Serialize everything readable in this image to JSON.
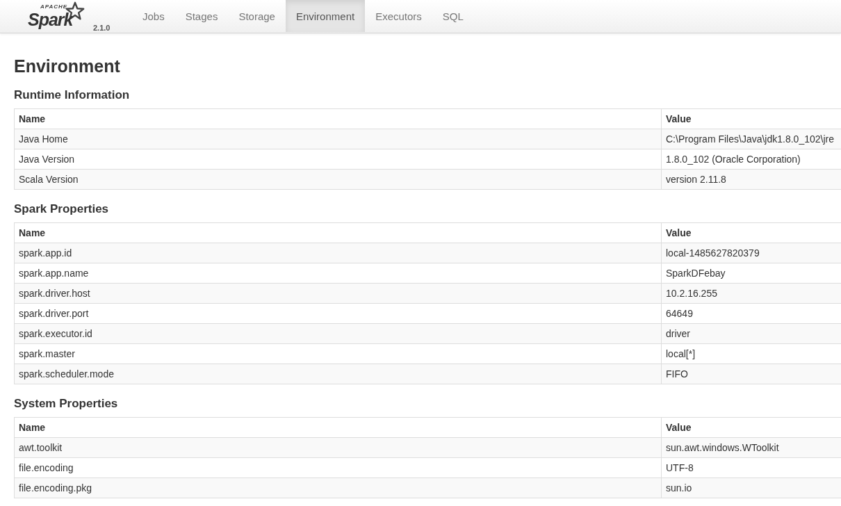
{
  "navbar": {
    "logo": {
      "small": "APACHE",
      "word": "Spark"
    },
    "version": "2.1.0",
    "tabs": [
      {
        "label": "Jobs",
        "selected": false
      },
      {
        "label": "Stages",
        "selected": false
      },
      {
        "label": "Storage",
        "selected": false
      },
      {
        "label": "Environment",
        "selected": true
      },
      {
        "label": "Executors",
        "selected": false
      },
      {
        "label": "SQL",
        "selected": false
      }
    ]
  },
  "title": "Environment",
  "sections": [
    {
      "title": "Runtime Information",
      "columns": [
        "Name",
        "Value"
      ],
      "rows": [
        [
          "Java Home",
          "C:\\Program Files\\Java\\jdk1.8.0_102\\jre"
        ],
        [
          "Java Version",
          "1.8.0_102 (Oracle Corporation)"
        ],
        [
          "Scala Version",
          "version 2.11.8"
        ]
      ]
    },
    {
      "title": "Spark Properties",
      "columns": [
        "Name",
        "Value"
      ],
      "rows": [
        [
          "spark.app.id",
          "local-1485627820379"
        ],
        [
          "spark.app.name",
          "SparkDFebay"
        ],
        [
          "spark.driver.host",
          "10.2.16.255"
        ],
        [
          "spark.driver.port",
          "64649"
        ],
        [
          "spark.executor.id",
          "driver"
        ],
        [
          "spark.master",
          "local[*]"
        ],
        [
          "spark.scheduler.mode",
          "FIFO"
        ]
      ]
    },
    {
      "title": "System Properties",
      "columns": [
        "Name",
        "Value"
      ],
      "rows": [
        [
          "awt.toolkit",
          "sun.awt.windows.WToolkit"
        ],
        [
          "file.encoding",
          "UTF-8"
        ],
        [
          "file.encoding.pkg",
          "sun.io"
        ]
      ]
    }
  ]
}
